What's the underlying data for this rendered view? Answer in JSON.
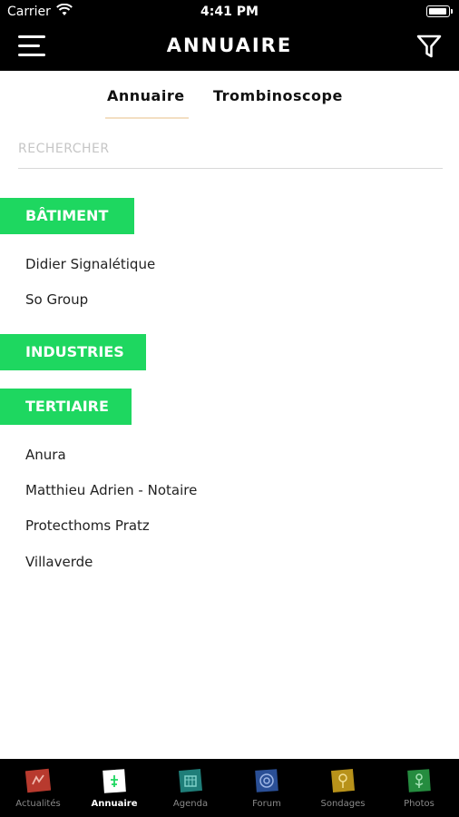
{
  "status_bar": {
    "carrier": "Carrier",
    "time": "4:41 PM"
  },
  "header": {
    "title": "ANNUAIRE"
  },
  "tabs": [
    {
      "label": "Annuaire",
      "active": true
    },
    {
      "label": "Trombinoscope",
      "active": false
    }
  ],
  "search": {
    "placeholder": "RECHERCHER",
    "value": ""
  },
  "categories": [
    {
      "label": "BÂTIMENT",
      "items": [
        "Didier Signalétique",
        "So Group"
      ]
    },
    {
      "label": "INDUSTRIES",
      "items": []
    },
    {
      "label": "TERTIAIRE",
      "items": [
        "Anura",
        "Matthieu Adrien - Notaire",
        "Protecthoms Pratz",
        "Villaverde"
      ]
    }
  ],
  "tabbar": [
    {
      "label": "Actualités",
      "icon": "news-icon",
      "color": "#c0392b",
      "active": false
    },
    {
      "label": "Annuaire",
      "icon": "directory-icon",
      "color": "#ffffff",
      "active": true
    },
    {
      "label": "Agenda",
      "icon": "calendar-icon",
      "color": "#1f8a84",
      "active": false
    },
    {
      "label": "Forum",
      "icon": "forum-icon",
      "color": "#2f5aa8",
      "active": false
    },
    {
      "label": "Sondages",
      "icon": "poll-icon",
      "color": "#c8a21c",
      "active": false
    },
    {
      "label": "Photos",
      "icon": "photos-icon",
      "color": "#2e9e4a",
      "active": false
    }
  ],
  "colors": {
    "accent_green": "#1ed760",
    "header_bg": "#000000",
    "tab_underline": "#f3dfc2"
  }
}
